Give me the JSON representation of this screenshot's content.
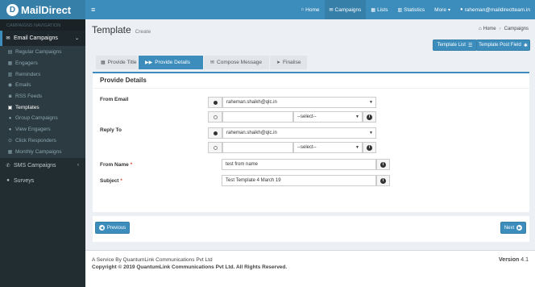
{
  "app": {
    "logo_text": "MailDirect",
    "logo_mark": "D"
  },
  "sidebar": {
    "heading": "CAMPAIGNS NAVIGATION",
    "email_campaigns": "Email Campaigns",
    "sub_items": [
      {
        "label": "Regular Campaigns",
        "icon": "regular-campaigns-icon"
      },
      {
        "label": "Engagers",
        "icon": "engagers-icon"
      },
      {
        "label": "Reminders",
        "icon": "reminders-icon"
      },
      {
        "label": "Emails",
        "icon": "emails-icon"
      },
      {
        "label": "RSS Feeds",
        "icon": "rss-icon"
      },
      {
        "label": "Templates",
        "icon": "templates-icon"
      },
      {
        "label": "Group Campaigns",
        "icon": "group-campaigns-icon"
      },
      {
        "label": "View Engagers",
        "icon": "view-engagers-icon"
      },
      {
        "label": "Click Responders",
        "icon": "click-responders-icon"
      },
      {
        "label": "Monthly Campaigns",
        "icon": "monthly-campaigns-icon"
      }
    ],
    "sms_campaigns": "SMS Campaigns",
    "surveys": "Surveys"
  },
  "topbar": {
    "home": "Home",
    "campaigns": "Campaigns",
    "lists": "Lists",
    "statistics": "Statistics",
    "more": "More",
    "user_email": "raheman@maildirectteam.in"
  },
  "page": {
    "title": "Template",
    "subtitle": "Create",
    "breadcrumb_home": "Home",
    "breadcrumb_current": "Campaigns",
    "template_list_button": "Template List",
    "template_post_field_button": "Template Post Field"
  },
  "wizard": {
    "step1": "Provide Title",
    "step2": "Provide Details",
    "step3": "Compose Message",
    "step4": "Finalise"
  },
  "form": {
    "panel_title": "Provide Details",
    "from_email_label": "From Email",
    "from_email_value": "raheman.shaikh@qlc.in",
    "reply_to_label": "Reply To",
    "reply_to_value": "raheman.shaikh@qlc.in",
    "select_placeholder": "--select--",
    "from_name_label": "From Name",
    "from_name_value": "test from name",
    "subject_label": "Subject",
    "subject_value": "Test Template 4 March 19",
    "required_mark": "*"
  },
  "navigation": {
    "previous": "Previous",
    "next": "Next"
  },
  "footer": {
    "service_line": "A Service By QuantumLink Communications Pvt Ltd",
    "copyright": "Copyright © 2019 QuantumLink Communications Pvt Ltd. All Rights Reserved.",
    "version_label": "Version",
    "version_number": "4.1"
  },
  "colors": {
    "primary": "#3c8dbc",
    "sidebar": "#222d32",
    "required": "#dd4b39"
  }
}
